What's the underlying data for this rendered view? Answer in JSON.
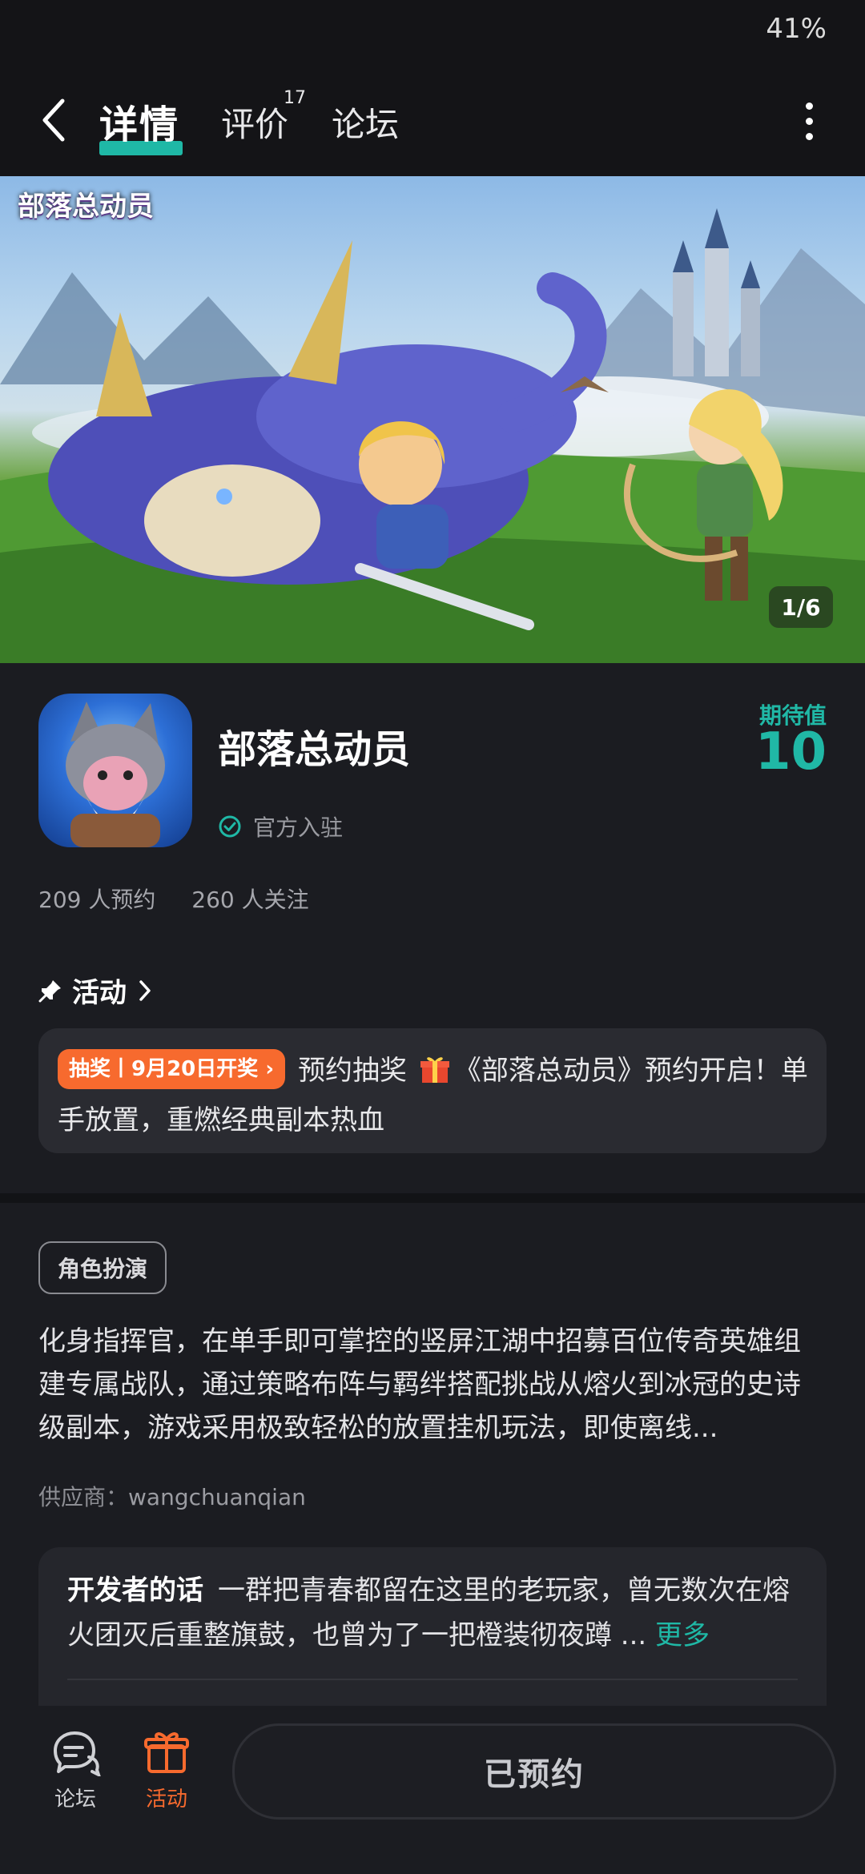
{
  "status_bar": {
    "battery": "41%"
  },
  "nav": {
    "tabs": [
      {
        "label": "详情"
      },
      {
        "label": "评价",
        "count": "17"
      },
      {
        "label": "论坛"
      }
    ]
  },
  "banner": {
    "logo_text": "部落总动员",
    "page_indicator": "1/6"
  },
  "app": {
    "name": "部落总动员",
    "official_label": "官方入驻",
    "expect_label": "期待值",
    "expect_value": "10",
    "reservations": "209 人预约",
    "followers": "260 人关注"
  },
  "activity": {
    "title": "活动",
    "badge": "抽奖丨9月20日开奖",
    "text_before_gift": "预约抽奖",
    "text_after_gift": "《部落总动员》预约开启！单手放置，重燃经典副本热血"
  },
  "game": {
    "genre": "角色扮演",
    "description": "化身指挥官，在单手即可掌控的竖屏江湖中招募百位传奇英雄组建专属战队，通过策略布阵与羁绊搭配挑战从熔火到冰冠的史诗级副本，游戏采用极致轻松的放置挂机玩法，即使离线...",
    "supplier_label": "供应商：",
    "supplier_name": "wangchuanqian"
  },
  "developer": {
    "label": "开发者的话",
    "text": "一群把青春都留在这里的老玩家，曾无数次在熔火团灭后重整旗鼓，也曾为了一把橙装彻夜蹲 ...",
    "more": "更多"
  },
  "bottom_bar": {
    "forum_label": "论坛",
    "activity_label": "活动",
    "reserve_button": "已预约"
  }
}
